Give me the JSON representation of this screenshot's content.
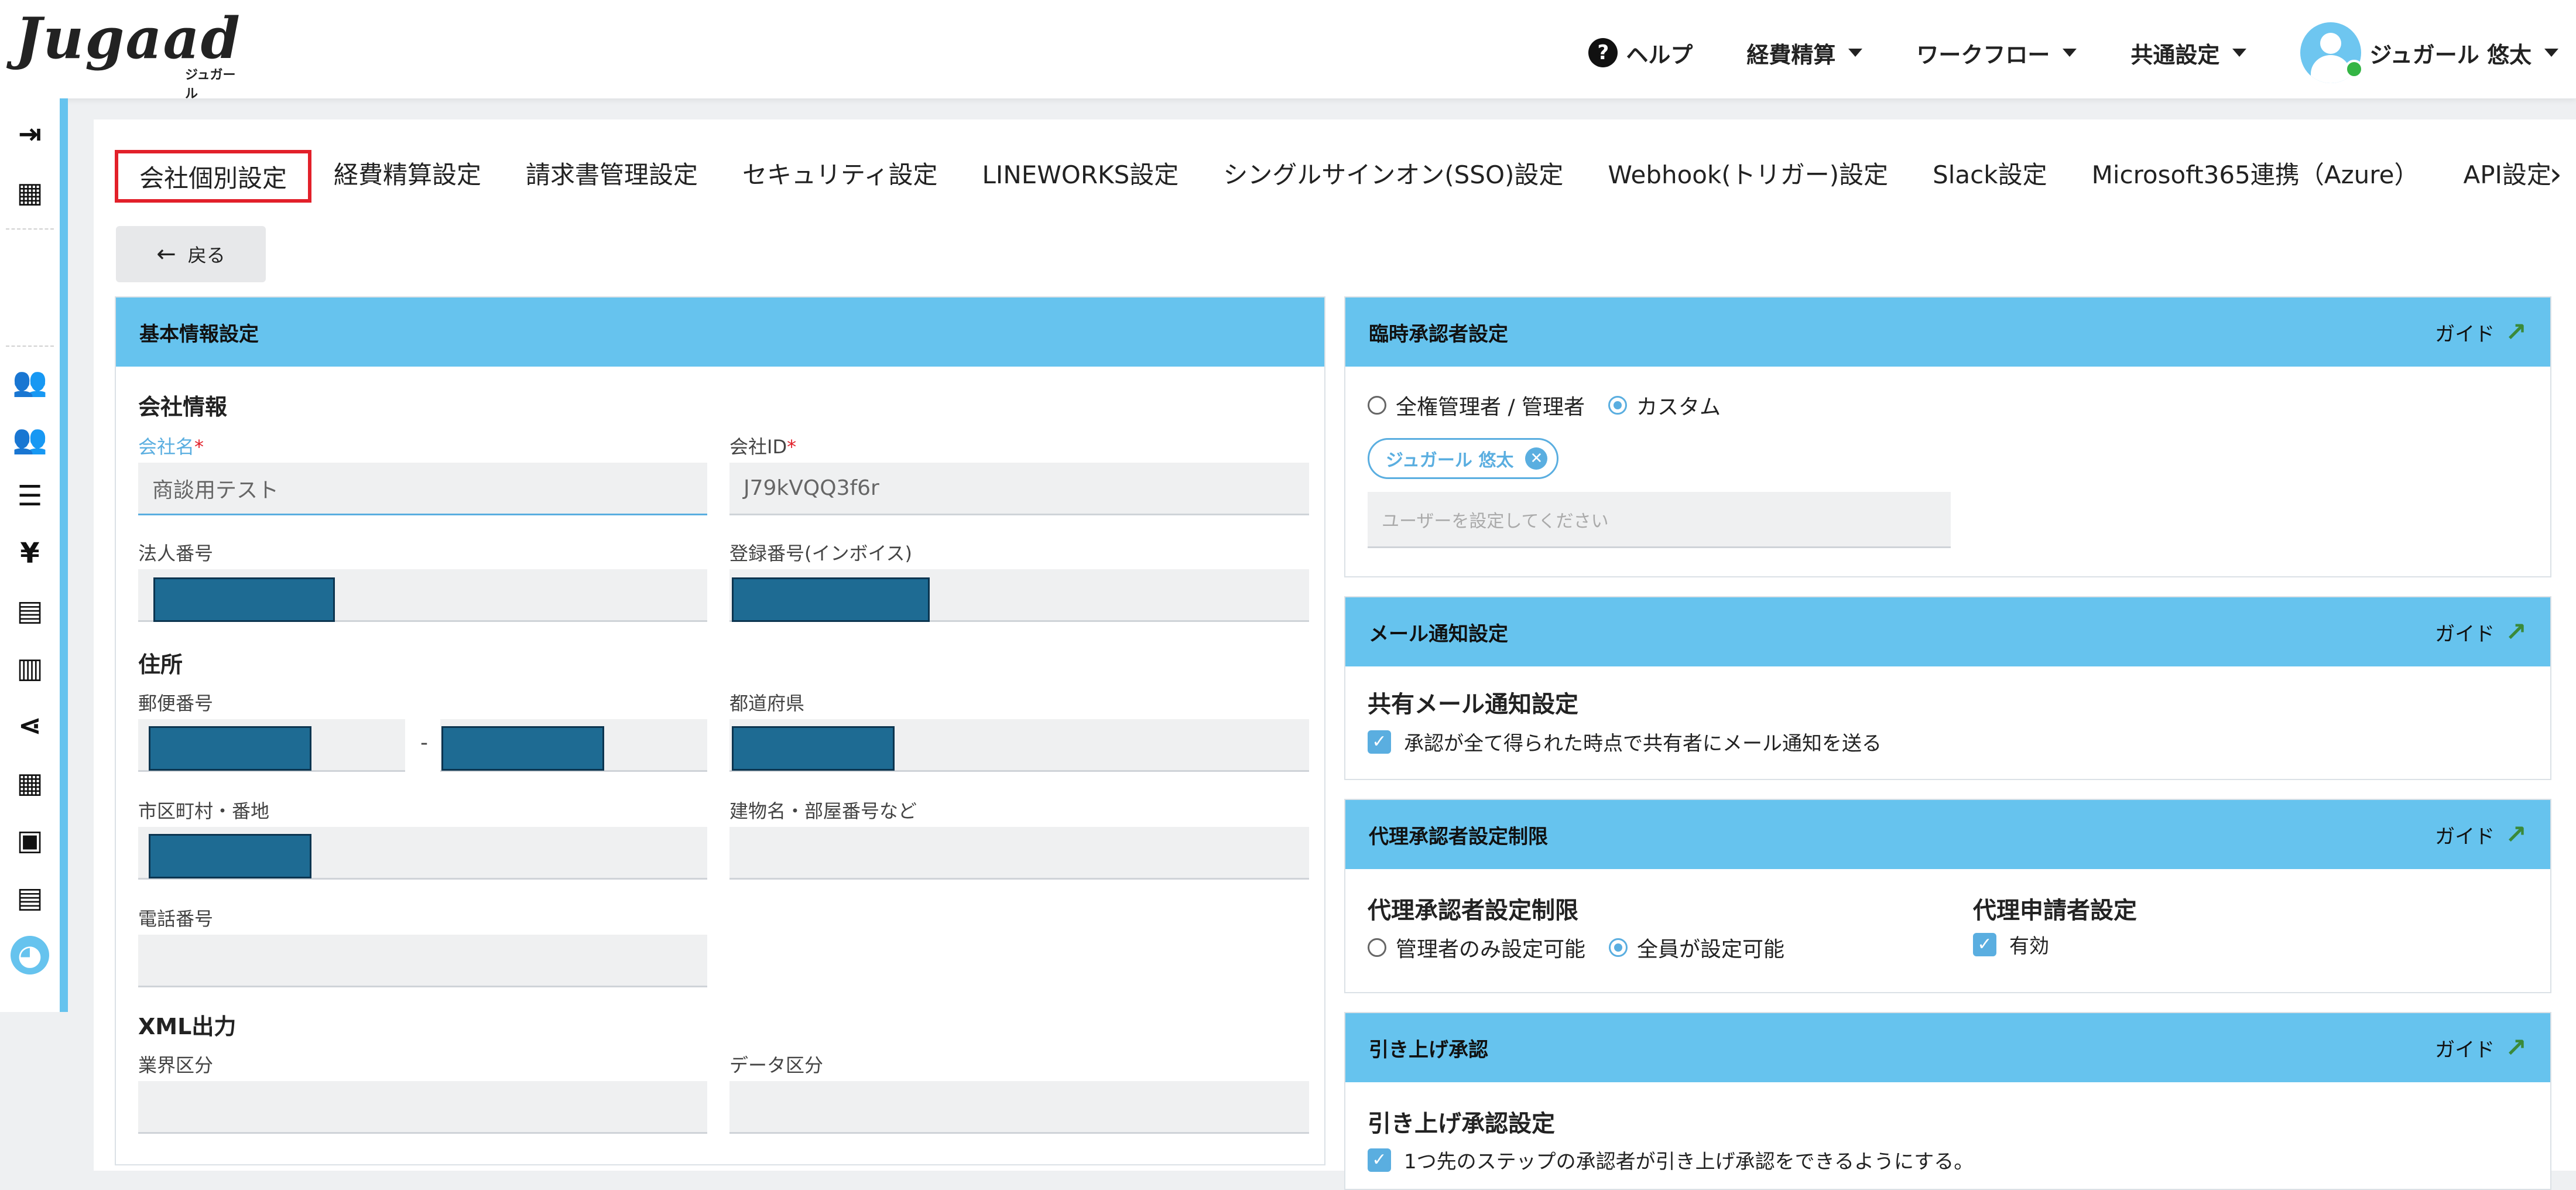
{
  "header": {
    "logo_text": "Jugaad",
    "logo_sub": "ジュガール",
    "help_label": "ヘルプ",
    "menus": [
      "経費精算",
      "ワークフロー",
      "共通設定"
    ],
    "user_name": "ジュガール 悠太"
  },
  "tabs": [
    "会社個別設定",
    "経費精算設定",
    "請求書管理設定",
    "セキュリティ設定",
    "LINEWORKS設定",
    "シングルサインオン(SSO)設定",
    "Webhook(トリガー)設定",
    "Slack設定",
    "Microsoft365連携（Azure）",
    "API設定"
  ],
  "back_button": "戻る",
  "basic_info": {
    "title": "基本情報設定",
    "company_section": "会社情報",
    "company_name_label": "会社名",
    "company_name_value": "商談用テスト",
    "company_id_label": "会社ID",
    "company_id_value": "J79kVQQ3f6r",
    "corporate_number_label": "法人番号",
    "registration_number_label": "登録番号(インボイス)",
    "address_section": "住所",
    "postal_label": "郵便番号",
    "postal_sep": "-",
    "prefecture_label": "都道府県",
    "city_label": "市区町村・番地",
    "building_label": "建物名・部屋番号など",
    "phone_label": "電話番号",
    "xml_section": "XML出力",
    "industry_label": "業界区分",
    "data_label": "データ区分"
  },
  "temp_approver": {
    "title": "臨時承認者設定",
    "guide": "ガイド",
    "option_admin": "全権管理者 / 管理者",
    "option_custom": "カスタム",
    "chip_user": "ジュガール 悠太",
    "user_placeholder": "ユーザーを設定してください"
  },
  "mail_notify": {
    "title": "メール通知設定",
    "guide": "ガイド",
    "subhead": "共有メール通知設定",
    "checkbox_label": "承認が全て得られた時点で共有者にメール通知を送る"
  },
  "proxy_limit": {
    "title": "代理承認者設定制限",
    "guide": "ガイド",
    "subhead": "代理承認者設定制限",
    "option_admin_only": "管理者のみ設定可能",
    "option_all": "全員が設定可能",
    "applicant_subhead": "代理申請者設定",
    "applicant_enabled": "有効"
  },
  "pullup": {
    "title": "引き上げ承認",
    "guide": "ガイド",
    "subhead": "引き上げ承認設定",
    "checkbox_label": "1つ先のステップの承認者が引き上げ承認をできるようにする。"
  }
}
